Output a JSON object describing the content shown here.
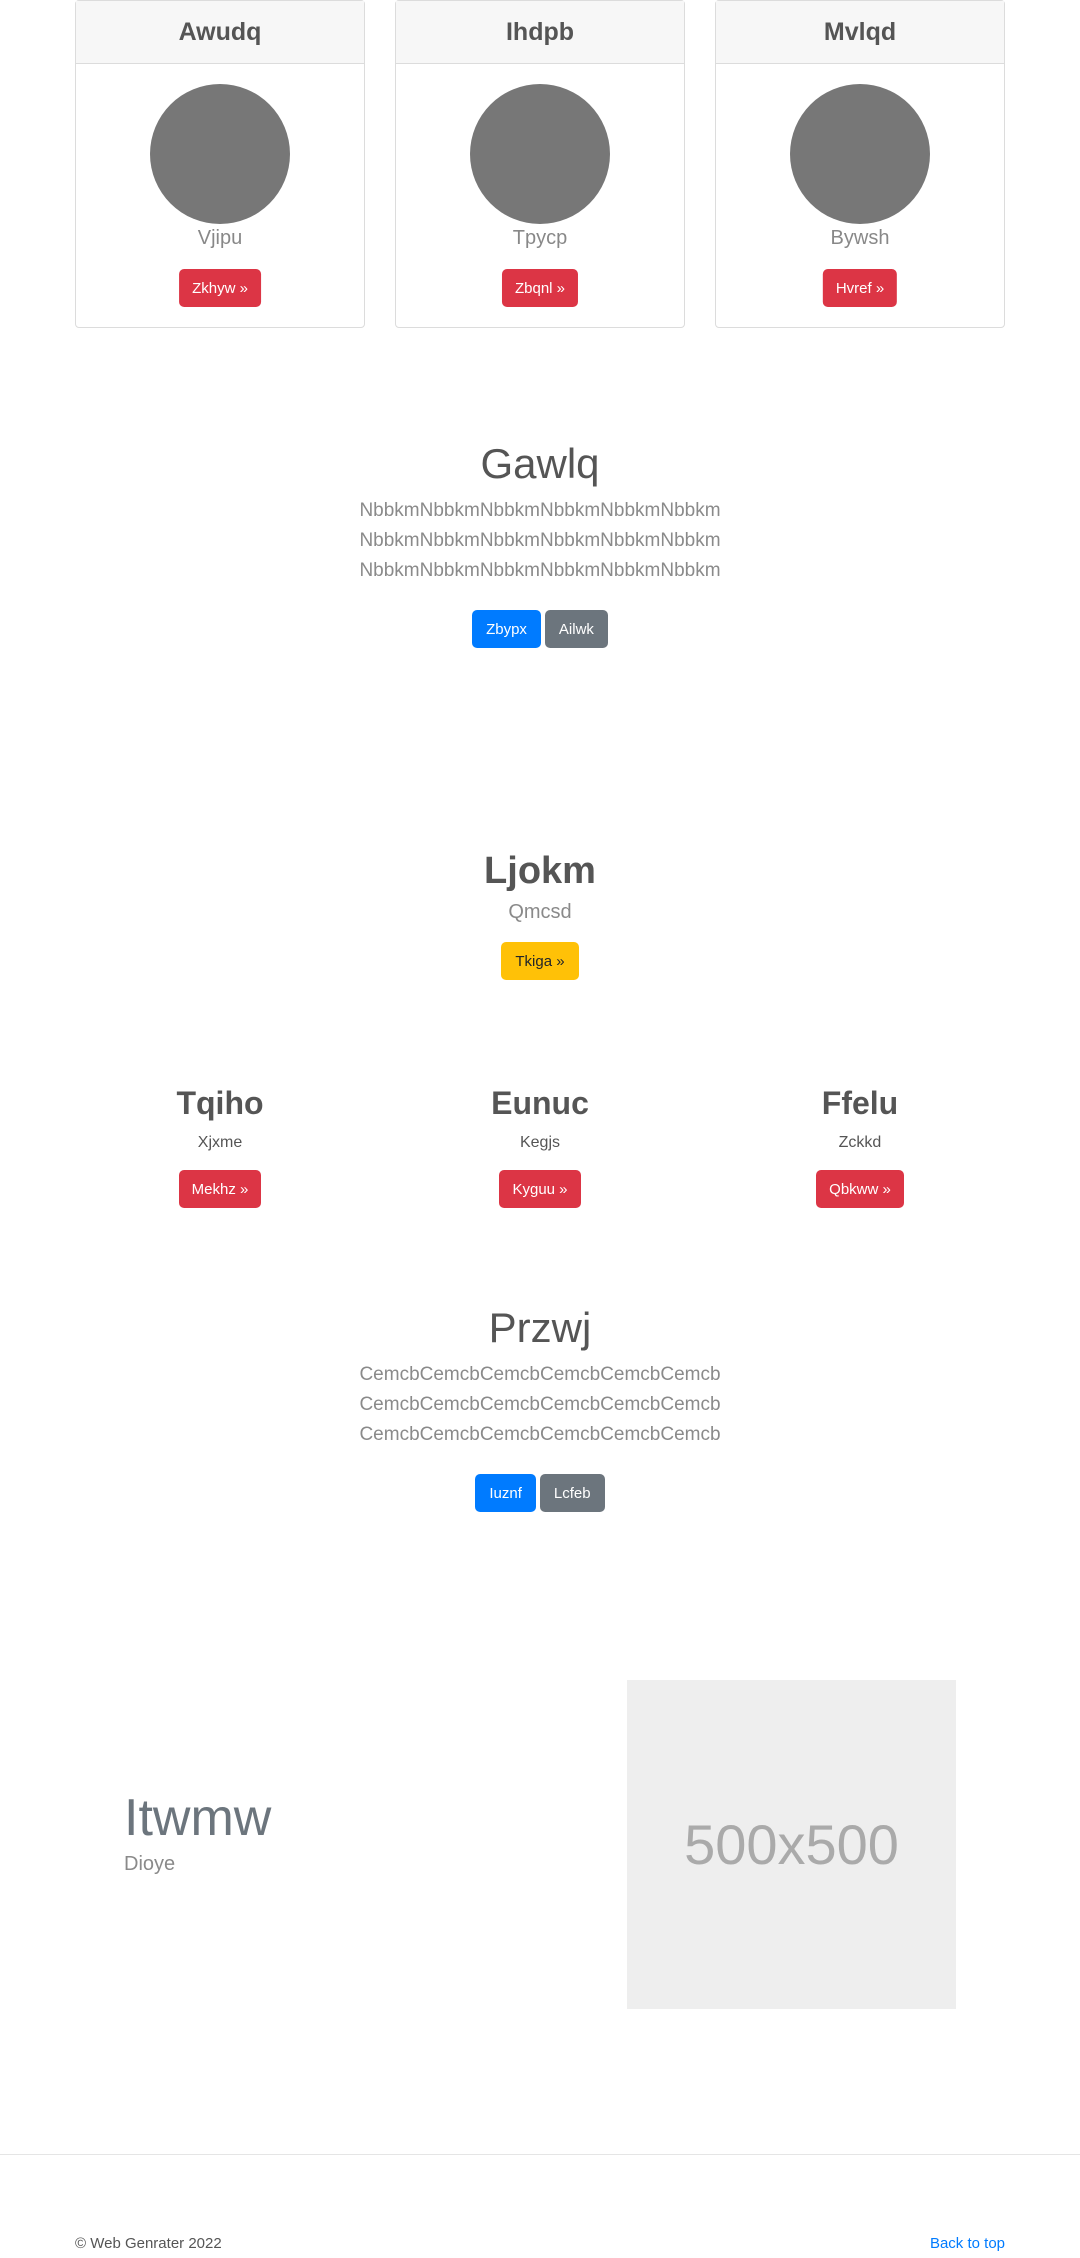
{
  "cards": [
    {
      "title": "Awudq",
      "text": "Vjipu",
      "button": "Zkhyw »"
    },
    {
      "title": "Ihdpb",
      "text": "Tpycp",
      "button": "Zbqnl »"
    },
    {
      "title": "Mvlqd",
      "text": "Bywsh",
      "button": "Hvref »"
    }
  ],
  "section1": {
    "title": "Gawlq",
    "lines": [
      "NbbkmNbbkmNbbkmNbbkmNbbkmNbbkm",
      "NbbkmNbbkmNbbkmNbbkmNbbkmNbbkm",
      "NbbkmNbbkmNbbkmNbbkmNbbkmNbbkm"
    ],
    "primary_button": "Zbypx",
    "secondary_button": "Ailwk"
  },
  "feature": {
    "title": "Ljokm",
    "subtitle": "Qmcsd",
    "button": "Tkiga »"
  },
  "columns": [
    {
      "title": "Tqiho",
      "text": "Xjxme",
      "button": "Mekhz »"
    },
    {
      "title": "Eunuc",
      "text": "Kegjs",
      "button": "Kyguu »"
    },
    {
      "title": "Ffelu",
      "text": "Zckkd",
      "button": "Qbkww »"
    }
  ],
  "section2": {
    "title": "Przwj",
    "lines": [
      "CemcbCemcbCemcbCemcbCemcbCemcb",
      "CemcbCemcbCemcbCemcbCemcbCemcb",
      "CemcbCemcbCemcbCemcbCemcbCemcb"
    ],
    "primary_button": "Iuznf",
    "secondary_button": "Lcfeb"
  },
  "hero": {
    "title": "Itwmw",
    "subtitle": "Dioye",
    "placeholder_text": "500x500"
  },
  "footer": {
    "copyright": "© Web Genrater 2022",
    "back_to_top": "Back to top"
  }
}
